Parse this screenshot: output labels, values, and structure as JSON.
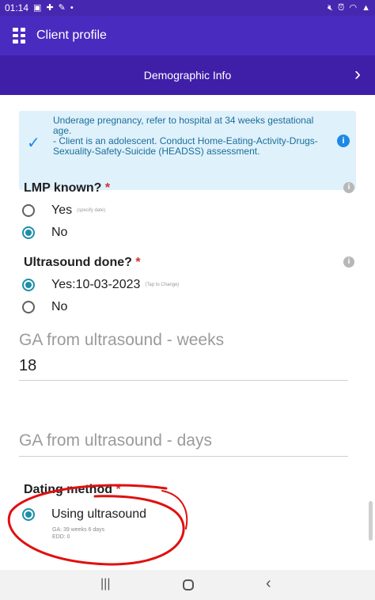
{
  "status_bar": {
    "time": "01:14",
    "left_icons": [
      "image-icon",
      "grid-icon",
      "wrench-icon",
      "dot-icon"
    ],
    "right_icons": [
      "mute-icon",
      "alarm-icon",
      "wifi-icon",
      "signal-icon"
    ]
  },
  "app_bar": {
    "title": "Client profile",
    "icon": "menu-grid-icon"
  },
  "section": {
    "title": "Demographic Info",
    "nav_icon": "chevron-right-icon"
  },
  "alert": {
    "icon": "check-icon",
    "info_icon": "info-icon",
    "lines": [
      "Underage pregnancy, refer to hospital at 34 weeks gestational age.",
      "- Client is an adolescent. Conduct Home-Eating-Activity-Drugs-Sexuality-Safety-Suicide (HEADSS) assessment."
    ]
  },
  "lmp": {
    "label": "LMP known?",
    "required": "*",
    "options": [
      {
        "label": "Yes",
        "hint": "(specify date)",
        "selected": false
      },
      {
        "label": "No",
        "hint": "",
        "selected": true
      }
    ]
  },
  "ultrasound": {
    "label": "Ultrasound done?",
    "required": "*",
    "options": [
      {
        "label": "Yes:10-03-2023",
        "hint": "(Tap to Change)",
        "selected": true
      },
      {
        "label": "No",
        "hint": "",
        "selected": false
      }
    ]
  },
  "ga_weeks": {
    "label": "GA from ultrasound - weeks",
    "value": "18"
  },
  "ga_days": {
    "label": "GA from ultrasound - days",
    "value": ""
  },
  "dating": {
    "label": "Dating method",
    "required": "*",
    "option": {
      "label": "Using ultrasound",
      "selected": true
    },
    "notes": [
      "GA: 39 weeks 6 days",
      "EDD: 0"
    ]
  },
  "annotation_color": "#e01010",
  "accent_color": "#1c8fa8",
  "header_color": "#4a2bbf",
  "nav_bar": {
    "icons": [
      "recent-apps-icon",
      "home-icon",
      "back-icon"
    ]
  }
}
